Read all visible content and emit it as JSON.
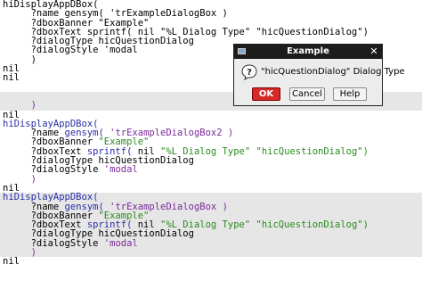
{
  "code_lines": [
    {
      "parts": [
        {
          "t": "hiDisplayAppDBox(",
          "c": "plain"
        }
      ]
    },
    {
      "parts": [
        {
          "t": "     ?name gensym( 'trExampleDialogBox )",
          "c": "plain"
        }
      ]
    },
    {
      "parts": [
        {
          "t": "     ?dboxBanner \"Example\"",
          "c": "plain"
        }
      ]
    },
    {
      "parts": [
        {
          "t": "     ?dboxText sprintf( nil \"%L Dialog Type\" \"hicQuestionDialog\")",
          "c": "plain"
        }
      ]
    },
    {
      "parts": [
        {
          "t": "     ?dialogType hicQuestionDialog",
          "c": "plain"
        }
      ]
    },
    {
      "parts": [
        {
          "t": "     ?dialogStyle 'modal",
          "c": "plain"
        }
      ]
    },
    {
      "parts": [
        {
          "t": "     )",
          "c": "plain"
        }
      ]
    },
    {
      "parts": [
        {
          "t": "nil",
          "c": "plain"
        }
      ]
    },
    {
      "parts": [
        {
          "t": "nil",
          "c": "plain"
        }
      ]
    },
    {
      "parts": [
        {
          "t": "",
          "c": "plain"
        }
      ]
    },
    {
      "parts": [
        {
          "t": "",
          "c": "plain"
        }
      ],
      "bg": true
    },
    {
      "parts": [
        {
          "t": "     )",
          "c": "sym"
        }
      ],
      "bg": true
    },
    {
      "parts": [
        {
          "t": "nil",
          "c": "plain"
        }
      ]
    },
    {
      "parts": [
        {
          "t": "hiDisplayAppDBox(",
          "c": "fn"
        }
      ]
    },
    {
      "parts": [
        {
          "t": "     ?name ",
          "c": "plain"
        },
        {
          "t": "gensym(",
          "c": "fn"
        },
        {
          "t": " 'trExampleDialogBox2 )",
          "c": "sym"
        }
      ]
    },
    {
      "parts": [
        {
          "t": "     ?dboxBanner ",
          "c": "plain"
        },
        {
          "t": "\"Example\"",
          "c": "str"
        }
      ]
    },
    {
      "parts": [
        {
          "t": "     ?dboxText ",
          "c": "plain"
        },
        {
          "t": "sprintf(",
          "c": "fn"
        },
        {
          "t": " nil ",
          "c": "plain"
        },
        {
          "t": "\"%L Dialog Type\"",
          "c": "str"
        },
        {
          "t": " ",
          "c": "plain"
        },
        {
          "t": "\"hicQuestionDialog\")",
          "c": "str"
        }
      ]
    },
    {
      "parts": [
        {
          "t": "     ?dialogType hicQuestionDialog",
          "c": "plain"
        }
      ]
    },
    {
      "parts": [
        {
          "t": "     ?dialogStyle ",
          "c": "plain"
        },
        {
          "t": "'modal",
          "c": "sym"
        }
      ]
    },
    {
      "parts": [
        {
          "t": "     )",
          "c": "sym"
        }
      ]
    },
    {
      "parts": [
        {
          "t": "nil",
          "c": "plain"
        }
      ]
    },
    {
      "parts": [
        {
          "t": "hiDisplayAppDBox(",
          "c": "fn"
        }
      ],
      "bg": true
    },
    {
      "parts": [
        {
          "t": "     ?name ",
          "c": "plain"
        },
        {
          "t": "gensym(",
          "c": "fn"
        },
        {
          "t": " 'trExampleDialogBox )",
          "c": "sym"
        }
      ],
      "bg": true
    },
    {
      "parts": [
        {
          "t": "     ?dboxBanner ",
          "c": "plain"
        },
        {
          "t": "\"Example\"",
          "c": "str"
        }
      ],
      "bg": true
    },
    {
      "parts": [
        {
          "t": "     ?dboxText ",
          "c": "plain"
        },
        {
          "t": "sprintf(",
          "c": "fn"
        },
        {
          "t": " nil ",
          "c": "plain"
        },
        {
          "t": "\"%L Dialog Type\"",
          "c": "str"
        },
        {
          "t": " ",
          "c": "plain"
        },
        {
          "t": "\"hicQuestionDialog\")",
          "c": "str"
        }
      ],
      "bg": true
    },
    {
      "parts": [
        {
          "t": "     ?dialogType hicQuestionDialog",
          "c": "plain"
        }
      ],
      "bg": true
    },
    {
      "parts": [
        {
          "t": "     ?dialogStyle ",
          "c": "plain"
        },
        {
          "t": "'modal",
          "c": "sym"
        }
      ],
      "bg": true
    },
    {
      "parts": [
        {
          "t": "     )",
          "c": "sym"
        }
      ],
      "bg": true
    },
    {
      "parts": [
        {
          "t": "nil",
          "c": "plain"
        }
      ]
    }
  ],
  "dialog": {
    "title": "Example",
    "close_glyph": "✕",
    "icon": "question-icon",
    "message": "\"hicQuestionDialog\" Dialog Type",
    "buttons": {
      "ok": "OK",
      "cancel": "Cancel",
      "help": "Help"
    }
  },
  "colors": {
    "background": "#ffffff",
    "highlight_band": "#e6e6e6",
    "function": "#2a2ea6",
    "string": "#2a8a1e",
    "symbol": "#7a2a9a",
    "titlebar": "#1c1c1c",
    "ok_button": "#d42a2a"
  }
}
